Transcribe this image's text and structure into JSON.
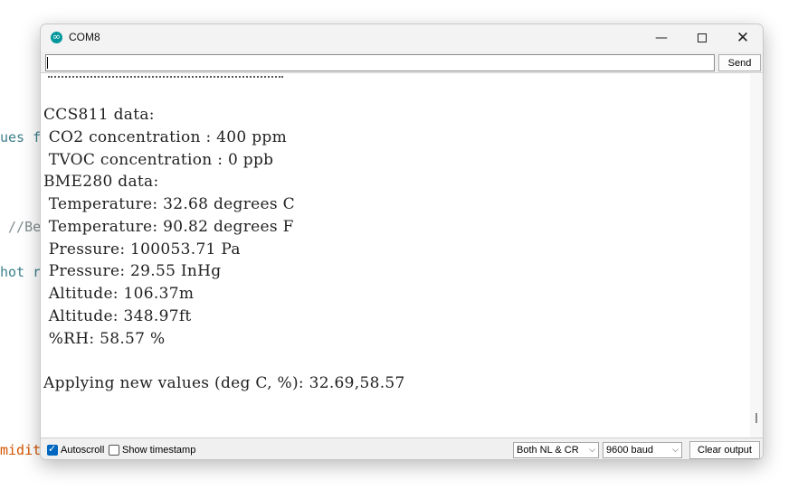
{
  "background_editor": {
    "fragments": [
      {
        "text": "ues f",
        "color": "#3d7f8c"
      },
      {
        "text": " //Be",
        "color": "#7f8c8d"
      },
      {
        "text": "hot r",
        "color": "#3d7f8c"
      },
      {
        "text": "midit",
        "color": "#d35400"
      }
    ]
  },
  "window": {
    "title": "COM8",
    "icon": "arduino-icon",
    "controls": {
      "minimize": "—",
      "close": "✕"
    }
  },
  "input_bar": {
    "value": "",
    "send_label": "Send"
  },
  "output": {
    "lines": [
      "CCS811 data:",
      " CO2 concentration : 400 ppm",
      " TVOC concentration : 0 ppb",
      "BME280 data:",
      " Temperature: 32.68 degrees C",
      " Temperature: 90.82 degrees F",
      " Pressure: 100053.71 Pa",
      " Pressure: 29.55 InHg",
      " Altitude: 106.37m",
      " Altitude: 348.97ft",
      " %RH: 58.57 %",
      "",
      "Applying new values (deg C, %): 32.69,58.57"
    ]
  },
  "footer": {
    "autoscroll": {
      "label": "Autoscroll",
      "checked": true
    },
    "show_timestamp": {
      "label": "Show timestamp",
      "checked": false
    },
    "line_ending": {
      "selected": "Both NL & CR"
    },
    "baud_rate": {
      "selected": "9600 baud"
    },
    "clear_label": "Clear output"
  },
  "colors": {
    "accent": "#0067c0",
    "arduino": "#00979c"
  }
}
